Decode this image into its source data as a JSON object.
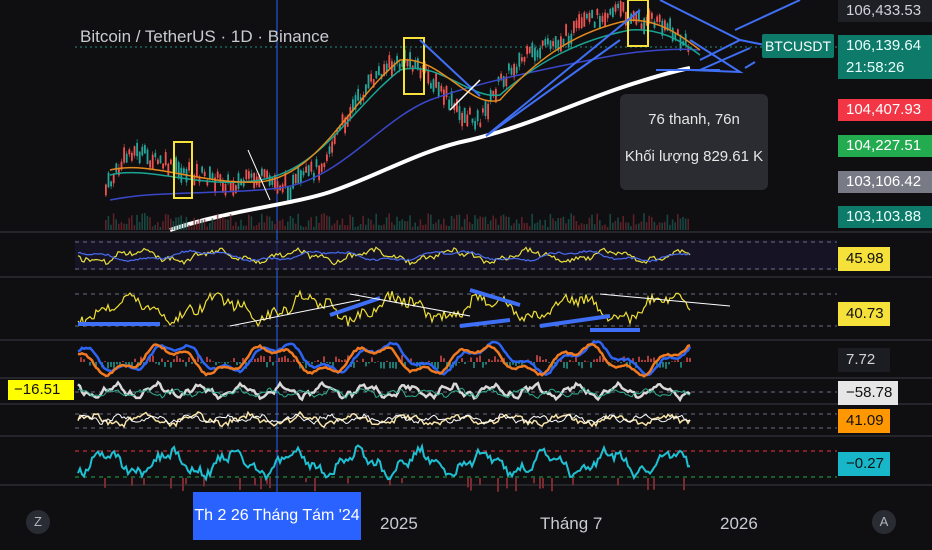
{
  "header": {
    "title": "Bitcoin / TetherUS · 1D · Binance",
    "symbol_badge": "BTCUSDT"
  },
  "price_axis": {
    "p1": "106,433.53",
    "p2": "106,139.64",
    "countdown": "21:58:26",
    "red_price": "104,407.93",
    "green_price": "104,227.51",
    "gray_price": "103,106.42",
    "teal_price": "103,103.88"
  },
  "tooltip": {
    "bars": "76 thanh, 76n",
    "volume": "Khối lượng 829.61 K"
  },
  "indicators": {
    "rsi": "45.98",
    "stoch": "40.73",
    "macd": "7.72",
    "osc_left": "−16.51",
    "osc_right": "−58.78",
    "osc2": "41.09",
    "cci": "−0.27"
  },
  "time_axis": {
    "current": "Th 2 26 Tháng Tám '24",
    "y2025": "2025",
    "july": "Tháng 7",
    "y2026": "2026"
  },
  "corner_buttons": {
    "left": "Z",
    "right": "A"
  },
  "colors": {
    "background": "#0f0f12",
    "blue_accent": "#2962ff",
    "teal_badge": "#0e7a6a",
    "red_label": "#f23645",
    "green_label": "#22ab4f",
    "yellow": "#f6e03a"
  }
}
